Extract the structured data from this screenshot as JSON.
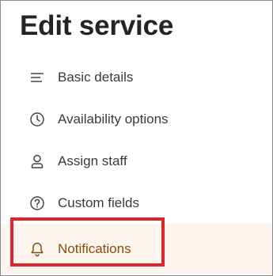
{
  "header": {
    "title": "Edit service"
  },
  "nav": {
    "items": [
      {
        "label": "Basic details",
        "icon": "text-align-left-icon"
      },
      {
        "label": "Availability options",
        "icon": "clock-icon"
      },
      {
        "label": "Assign staff",
        "icon": "person-icon"
      },
      {
        "label": "Custom fields",
        "icon": "question-circle-icon"
      },
      {
        "label": "Notifications",
        "icon": "bell-icon",
        "active": true
      }
    ]
  },
  "colors": {
    "title_text": "#242424",
    "item_text": "#3a3a3a",
    "active_text": "#8a4b10",
    "active_background": "#fdf5ee",
    "highlight_border": "#e0242b"
  }
}
